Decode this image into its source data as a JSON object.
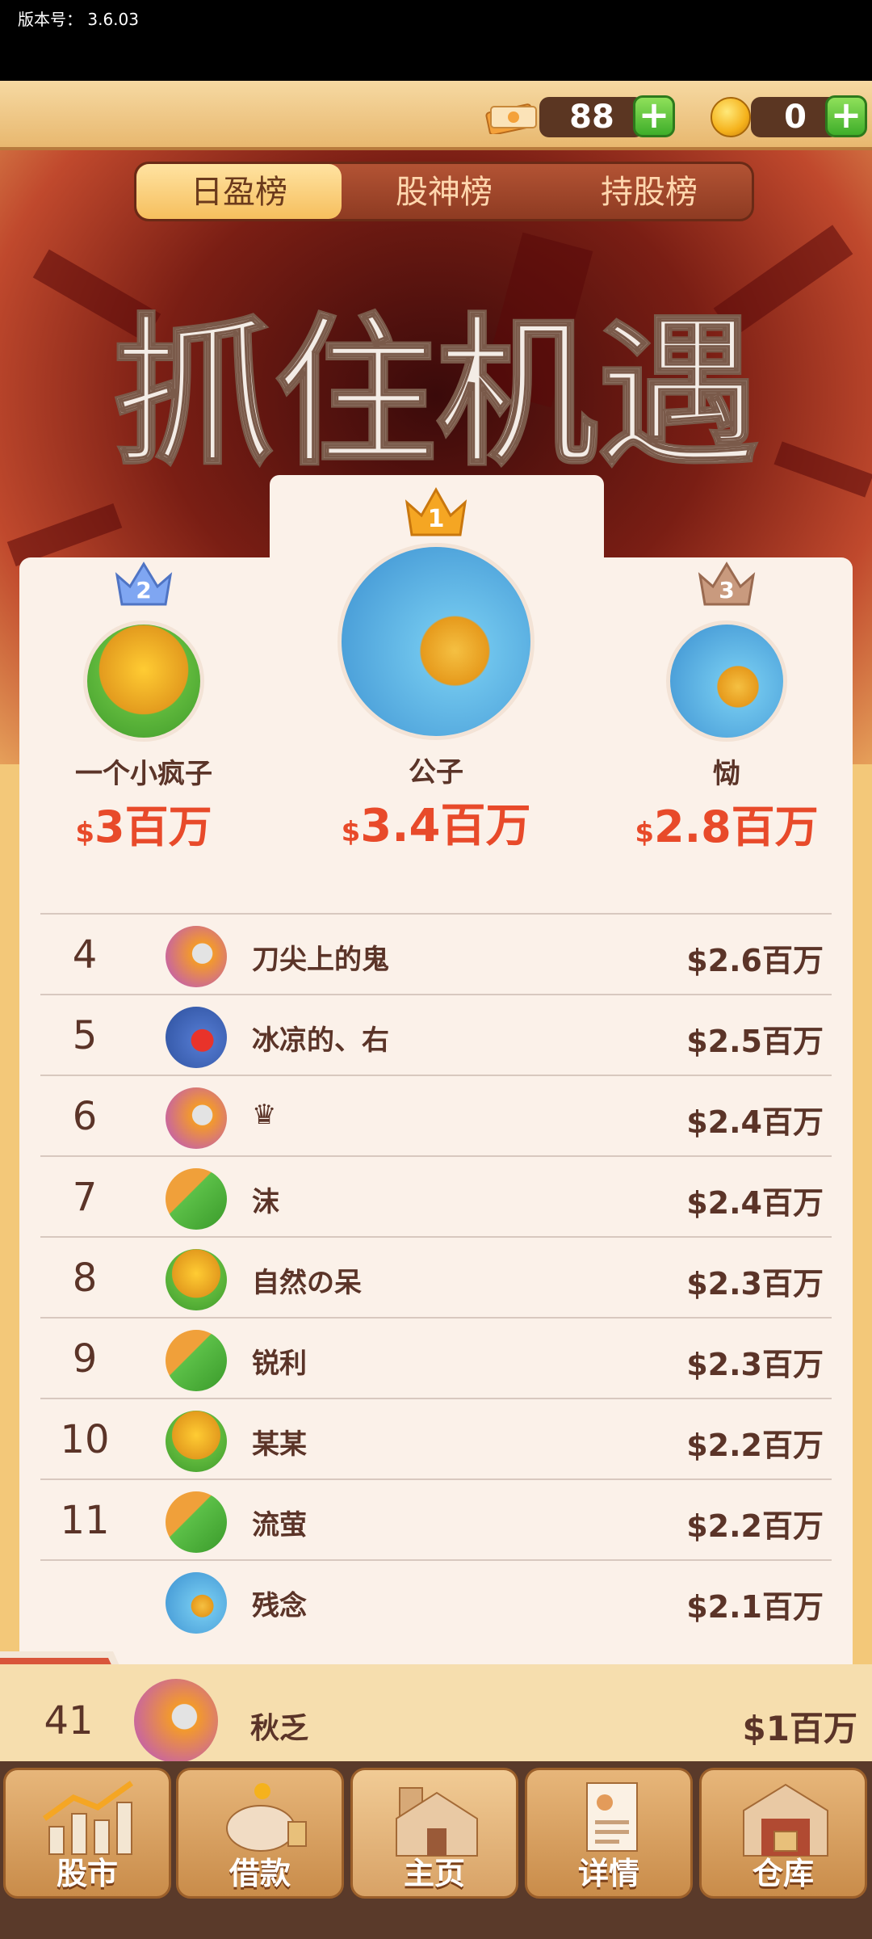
{
  "version_label": "版本号： 3.6.03",
  "currency": {
    "cash": "88",
    "coins": "0",
    "plus": "+"
  },
  "tabs": [
    "日盈榜",
    "股神榜",
    "持股榜"
  ],
  "active_tab": 0,
  "slogan": "抓住机遇",
  "podium": [
    {
      "rank": "2",
      "name": "一个小疯子",
      "dollar": "$",
      "amount": "3百万",
      "badge_color": "#7fa6f2"
    },
    {
      "rank": "1",
      "name": "公子",
      "dollar": "$",
      "amount": "3.4百万",
      "badge_color": "#f5a623"
    },
    {
      "rank": "3",
      "name": "恸",
      "dollar": "$",
      "amount": "2.8百万",
      "badge_color": "#c99a7e"
    }
  ],
  "list": [
    {
      "rank": "4",
      "name": "刀尖上的鬼",
      "amount": "$2.6百万"
    },
    {
      "rank": "5",
      "name": "冰凉的、右",
      "amount": "$2.5百万"
    },
    {
      "rank": "6",
      "name": "♛",
      "amount": "$2.4百万"
    },
    {
      "rank": "7",
      "name": "沫",
      "amount": "$2.4百万"
    },
    {
      "rank": "8",
      "name": "自然の呆",
      "amount": "$2.3百万"
    },
    {
      "rank": "9",
      "name": "锐利",
      "amount": "$2.3百万"
    },
    {
      "rank": "10",
      "name": "某某",
      "amount": "$2.2百万"
    },
    {
      "rank": "11",
      "name": "流萤",
      "amount": "$2.2百万"
    },
    {
      "rank": "",
      "name": "残念",
      "amount": "$2.1百万"
    }
  ],
  "my_rank": {
    "rank": "41",
    "name": "秋乏",
    "amount": "$1百万"
  },
  "nav": [
    "股市",
    "借款",
    "主页",
    "详情",
    "仓库"
  ],
  "active_nav": 2
}
